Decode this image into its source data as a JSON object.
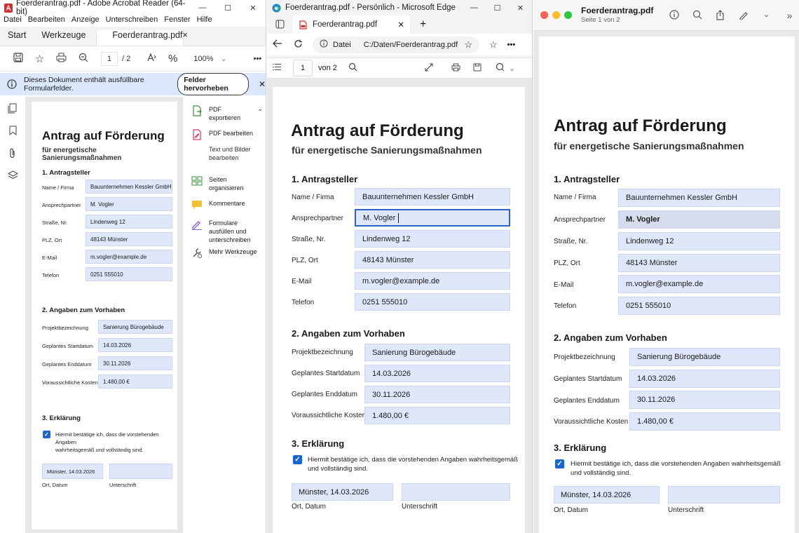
{
  "acrobat": {
    "title": "Foerderantrag.pdf - Adobe Acrobat Reader (64-bit)",
    "window_controls": [
      "—",
      "☐",
      "✕"
    ],
    "menu": [
      "Datei",
      "Bearbeiten",
      "Anzeige",
      "Unterschreiben",
      "Fenster",
      "Hilfe"
    ],
    "tabs": {
      "start": "Start",
      "tools": "Werkzeuge",
      "doc": "Foerderantrag.pdf",
      "close": "×"
    },
    "toolbar": {
      "page_current": "1",
      "page_total": "/ 2",
      "zoom": "100%",
      "zoom_caret": "⌄",
      "more": "•••"
    },
    "info": {
      "text": "Dieses Dokument enthält ausfüllbare Formularfelder.",
      "button": "Felder hervorheben",
      "close": "✕"
    },
    "panel": [
      {
        "label": "PDF exportieren",
        "color": "#3a8f3a"
      },
      {
        "label": "PDF bearbeiten",
        "color": "#d8356b"
      },
      {
        "label": "Text und Bilder bearbeiten",
        "color": ""
      },
      {
        "label": "Seiten organisieren",
        "color": "#3a8f3a"
      },
      {
        "label": "Kommentare",
        "color": "#e6b800"
      },
      {
        "label": "Formulare ausfüllen und unterschreiben",
        "color": "#8a5bd6"
      },
      {
        "label": "Mehr Werkzeuge",
        "color": "#555"
      }
    ]
  },
  "edge": {
    "title": "Foerderantrag.pdf - Persönlich - Microsoft Edge",
    "window_controls": [
      "—",
      "☐",
      "✕"
    ],
    "tab": {
      "label": "Foerderantrag.pdf",
      "close": "✕",
      "new": "+"
    },
    "address": {
      "scheme": "Datei",
      "path": "C:/Daten/Foerderantrag.pdf"
    },
    "pdfbar": {
      "page_current": "1",
      "page_total": "von 2"
    }
  },
  "preview": {
    "title": "Foerderantrag.pdf",
    "subtitle": "Seite 1 von 2",
    "dot_colors": [
      "#fe5f57",
      "#febc2e",
      "#28c840"
    ]
  },
  "form": {
    "title": "Antrag auf Förderung",
    "subtitle": "für energetische Sanierungsmaßnahmen",
    "sec1": "1. Antragsteller",
    "applicant": [
      {
        "label": "Name / Firma",
        "value": "Bauunternehmen Kessler GmbH"
      },
      {
        "label": "Ansprechpartner",
        "value": "M. Vogler"
      },
      {
        "label": "Straße, Nr.",
        "value": "Lindenweg 12"
      },
      {
        "label": "PLZ, Ort",
        "value": "48143 Münster"
      },
      {
        "label": "E-Mail",
        "value": "m.vogler@example.de"
      },
      {
        "label": "Telefon",
        "value": "0251 555010"
      }
    ],
    "sec2": "2. Angaben zum Vorhaben",
    "project": [
      {
        "label": "Projektbezeichnung",
        "value": "Sanierung Bürogebäude"
      },
      {
        "label": "Geplantes Startdatum",
        "value": "14.03.2026"
      },
      {
        "label": "Geplantes Enddatum",
        "value": "30.11.2026"
      },
      {
        "label": "Voraussichtliche Kosten",
        "value": "1.480,00 €"
      }
    ],
    "sec3": "3. Erklärung",
    "confirm_a": "Hiermit bestätige ich, dass die vorstehenden Angaben",
    "confirm_b": "wahrheitsgemäß und vollständig sind.",
    "confirm_c": "Hiermit bestätige ich, dass die vorstehenden Angaben wahrheitsgemäß",
    "confirm_d": "und vollständig sind.",
    "checked": true,
    "place_date": "Münster, 14.03.2026",
    "place_date_label": "Ort, Datum",
    "signature": "",
    "signature_label": "Unterschrift"
  }
}
